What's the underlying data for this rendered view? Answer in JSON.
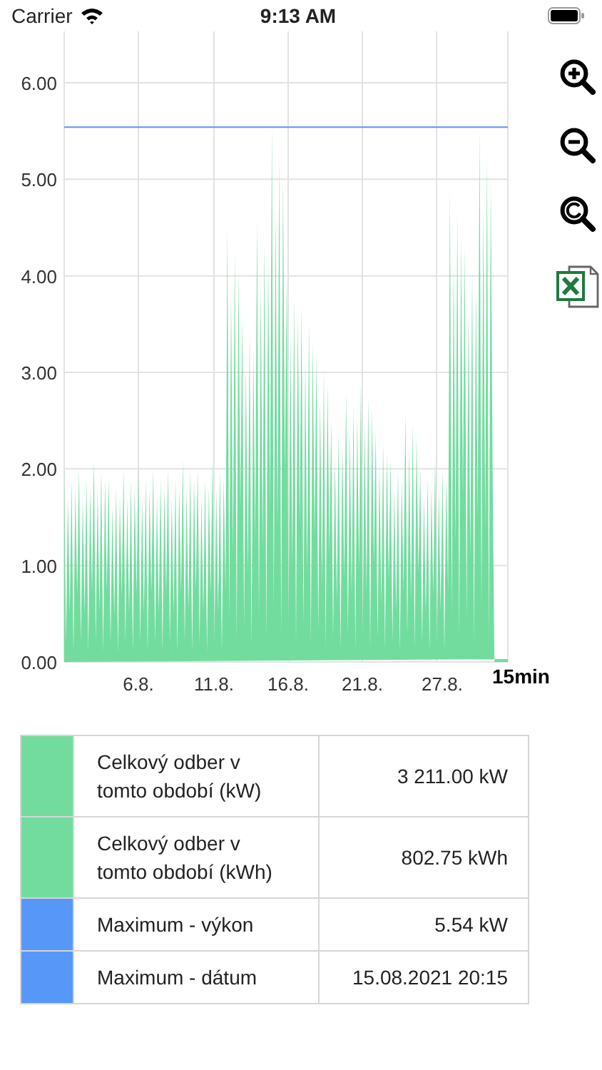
{
  "status_bar": {
    "carrier": "Carrier",
    "time": "9:13 AM"
  },
  "chart": {
    "y_ticks": [
      "6.00",
      "5.00",
      "4.00",
      "3.00",
      "2.00",
      "1.00",
      "0.00"
    ],
    "x_ticks": [
      "6.8.",
      "11.8.",
      "16.8.",
      "21.8.",
      "27.8."
    ],
    "x_unit": "15min"
  },
  "toolbar": [
    {
      "kind": "zoom-in"
    },
    {
      "kind": "zoom-out"
    },
    {
      "kind": "reset"
    },
    {
      "kind": "excel"
    }
  ],
  "legend": [
    {
      "color": "#72dc9f",
      "label": "Celkový odber v tomto období (kW)",
      "value": "3 211.00 kW"
    },
    {
      "color": "#72dc9f",
      "label": "Celkový odber v tomto období (kWh)",
      "value": "802.75 kWh"
    },
    {
      "color": "#5797f8",
      "label": "Maximum - výkon",
      "value": "5.54 kW"
    },
    {
      "color": "#5797f8",
      "label": "Maximum - dátum",
      "value": "15.08.2021 20:15"
    }
  ]
}
